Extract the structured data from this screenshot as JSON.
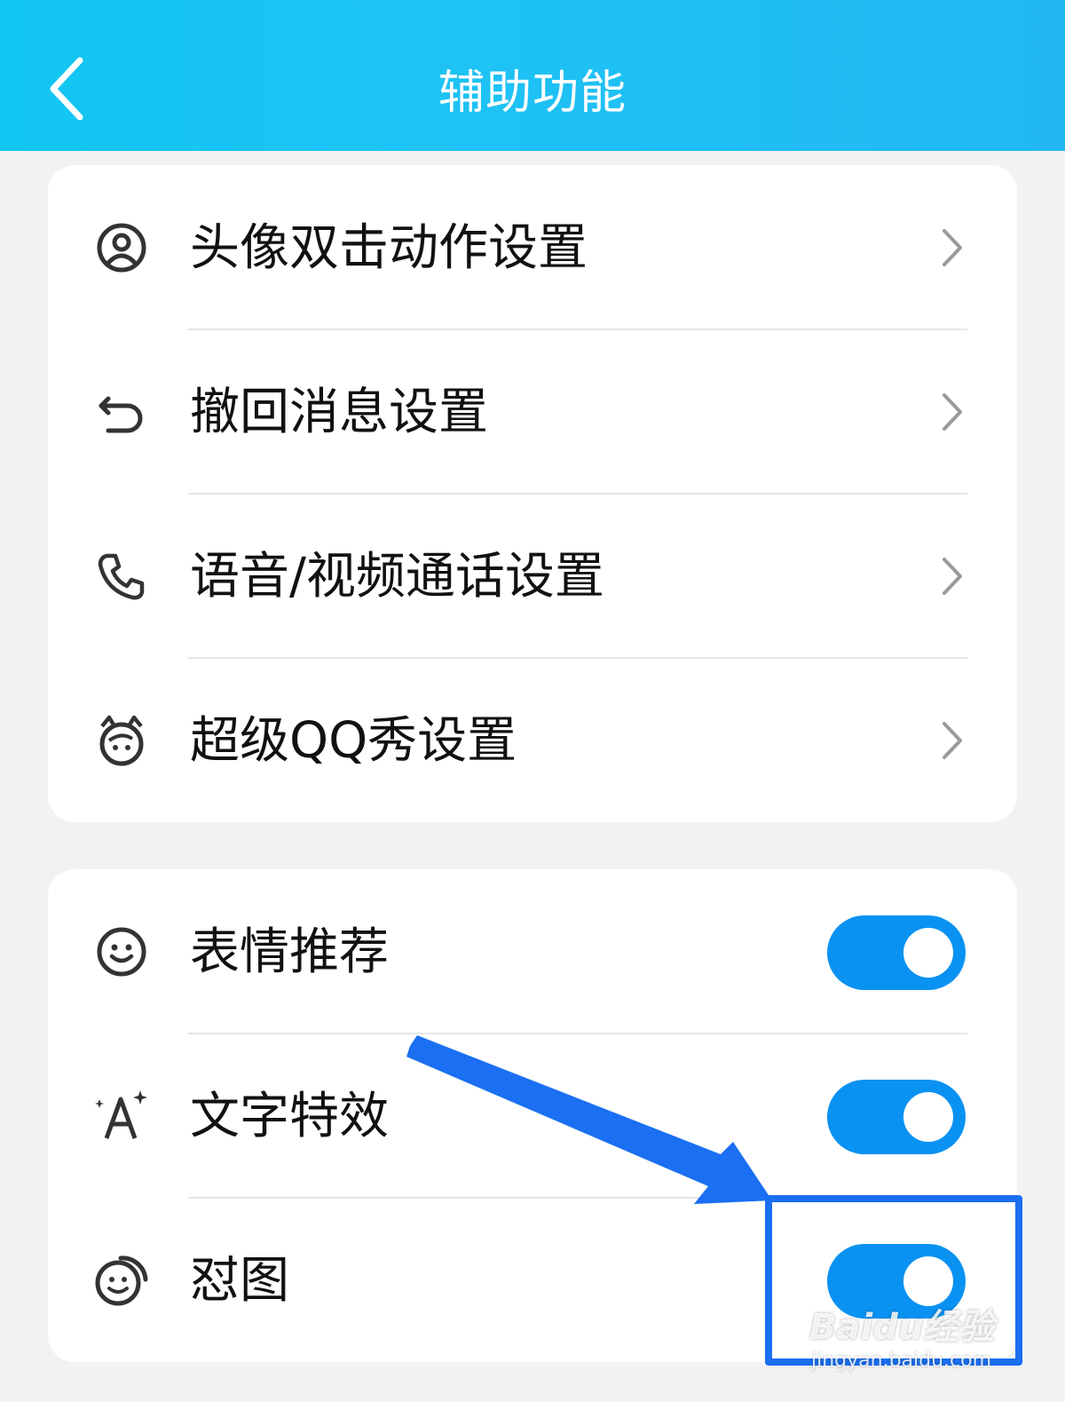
{
  "header": {
    "title": "辅助功能",
    "back_icon": "chevron-left-icon"
  },
  "settings_group": {
    "items": [
      {
        "label": "头像双击动作设置",
        "icon": "avatar-icon"
      },
      {
        "label": "撤回消息设置",
        "icon": "undo-icon"
      },
      {
        "label": "语音/视频通话设置",
        "icon": "phone-icon"
      },
      {
        "label": "超级QQ秀设置",
        "icon": "qq-show-icon"
      }
    ]
  },
  "toggle_group": {
    "items": [
      {
        "label": "表情推荐",
        "icon": "smiley-icon",
        "on": true
      },
      {
        "label": "文字特效",
        "icon": "text-effect-icon",
        "on": true
      },
      {
        "label": "怼图",
        "icon": "sticker-reply-icon",
        "on": true
      }
    ]
  },
  "colors": {
    "header": "#1ec3f4",
    "toggle_on": "#0a92f2",
    "annotation": "#1a6ff2"
  },
  "watermark": {
    "logo": "Baidu经验",
    "url": "jingyan.baidu.com"
  }
}
